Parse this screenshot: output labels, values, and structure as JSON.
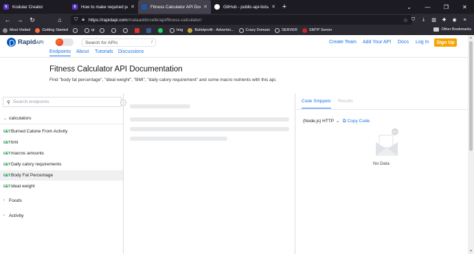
{
  "browser": {
    "tabs": [
      {
        "title": "Kodular Creator",
        "icon_color": "#5b35c8",
        "icon_letter": "k"
      },
      {
        "title": "How to make required parame",
        "icon_color": "#5b35c8",
        "icon_letter": "k"
      },
      {
        "title": "Fitness Calculator API Documen",
        "icon_color": "#2255aa",
        "icon_letter": ""
      },
      {
        "title": "GitHub - public-api-lists/public",
        "icon_color": "#ffffff",
        "icon_letter": ""
      }
    ],
    "url_host": "https://rapidapi.com",
    "url_path": "/malaaddincelik/api/fitness-calculator/",
    "bookmarks": [
      "Most Visited",
      "Getting Started",
      "",
      "qr",
      "",
      "",
      "",
      "",
      "",
      "",
      "Img",
      "Bulletprofit - Advertisi...",
      "Crazy Domain",
      "SERVER",
      "SMTP Server"
    ],
    "other_bookmarks": "Other Bookmarks"
  },
  "header": {
    "brand_main": "Rapid",
    "brand_sub": "API",
    "search_placeholder": "Search for APIs",
    "search_shortcut": "/",
    "links": [
      "Create Team",
      "Add Your API",
      "Docs",
      "Log In"
    ],
    "signup": "Sign Up",
    "subnav": [
      "Endpoints",
      "About",
      "Tutorials",
      "Discussions"
    ]
  },
  "page": {
    "title": "Fitness Calculator API Documentation",
    "description": "Find \"body fat percentage\", \"ideal weight\", \"BMI\", \"daily calory requirement\" and some macro nutrients with this api."
  },
  "sidebar": {
    "search_placeholder": "Search endpoints",
    "groups": [
      "calculators",
      "Foods",
      "Activity"
    ],
    "method": "GET",
    "endpoints": [
      "Burned Calorie From Activity",
      "bmi",
      "macros amounts",
      "Daily calory requirements",
      "Body Fat Percentage",
      "Ideal weight"
    ]
  },
  "right": {
    "tabs": [
      "Code Snippets",
      "Results"
    ],
    "language": "(Node.js) HTTP",
    "copy_code": "Copy Code",
    "empty": "No Data"
  },
  "colors": {
    "accent": "#1a73e8",
    "signup": "#f5a300",
    "get_method": "#0a8a3a"
  }
}
